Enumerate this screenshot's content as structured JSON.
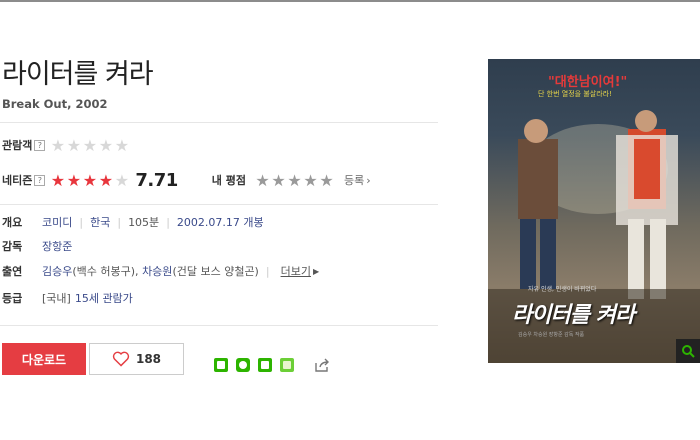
{
  "movie": {
    "title": "라이터를 켜라",
    "subtitle": "Break Out, 2002"
  },
  "ratings": {
    "audience_label": "관람객",
    "audience_help": "?",
    "netizen_label": "네티즌",
    "netizen_help": "?",
    "netizen_score": "7.71",
    "netizen_stars_filled": 4,
    "my_rating_label": "내 평점",
    "register_label": "등록",
    "register_arrow": "›"
  },
  "info": {
    "overview_label": "개요",
    "genre": "코미디",
    "country": "한국",
    "runtime": "105분",
    "release": "2002.07.17 개봉",
    "director_label": "감독",
    "director": "장항준",
    "cast_label": "출연",
    "cast_1": "김승우",
    "cast_1_role": "(백수 허봉구), ",
    "cast_2": "차승원",
    "cast_2_role": "(건달 보스 양철곤)",
    "more": "더보기",
    "grade_label": "등급",
    "grade_region": "[국내]",
    "grade": "15세 관람가"
  },
  "actions": {
    "download": "다운로드",
    "like_count": "188"
  },
  "poster": {
    "headline": "\"대한남이여!\"",
    "sub": "단 한번 열정을 불살라라!",
    "caption": "자유 인생, 인생이 바뀌었다",
    "title": "라이터를 켜라",
    "credits": "김승우 차승원 장항준 감독 작품"
  },
  "colors": {
    "accent_red": "#e53d42",
    "link_blue": "#3a4a8a",
    "star_red": "#e8363d",
    "share_green": "#2db400"
  }
}
